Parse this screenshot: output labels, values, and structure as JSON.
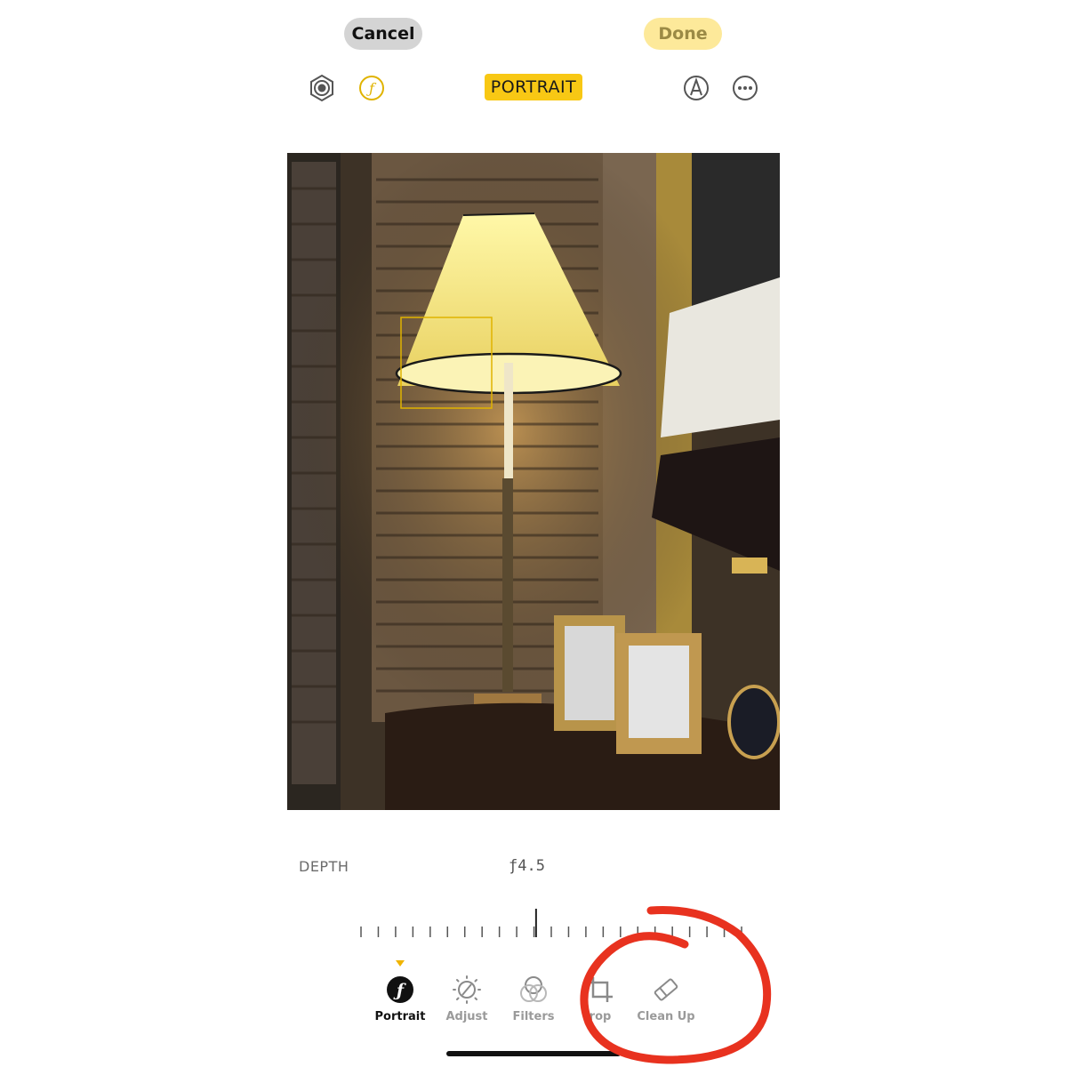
{
  "header": {
    "cancel_label": "Cancel",
    "done_label": "Done",
    "mode_badge": "PORTRAIT"
  },
  "toolbar": {
    "icons": [
      "live-photo-icon",
      "aperture-f-icon",
      "markup-pen-icon",
      "more-ellipsis-icon"
    ],
    "accent_color": "#f8c814"
  },
  "photo": {
    "subject": "table-lamp-scene"
  },
  "depth": {
    "label": "DEPTH",
    "value": "ƒ4.5",
    "slider_position": 0.46
  },
  "tabs": [
    {
      "label": "Portrait",
      "icon": "portrait-f-icon",
      "selected": true
    },
    {
      "label": "Adjust",
      "icon": "adjust-dial-icon",
      "selected": false
    },
    {
      "label": "Filters",
      "icon": "filters-circles-icon",
      "selected": false
    },
    {
      "label": "rop",
      "icon": "crop-icon",
      "selected": false
    },
    {
      "label": "Clean Up",
      "icon": "eraser-icon",
      "selected": false
    }
  ],
  "annotation_color": "#e8321f"
}
